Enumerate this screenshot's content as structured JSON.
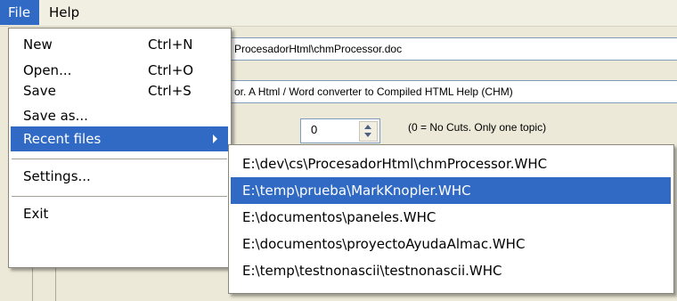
{
  "menubar": {
    "file_label": "File",
    "help_label": "Help"
  },
  "window": {
    "source_file": "ProcesadorHtml\\chmProcessor.doc",
    "title": "or. A Html / Word converter to Compiled HTML Help (CHM)",
    "cut_level": "0",
    "cut_level_hint": "(0 = No Cuts. Only one topic)"
  },
  "file_menu": {
    "new": {
      "label": "New",
      "shortcut": "Ctrl+N"
    },
    "open": {
      "label": "Open...",
      "shortcut": "Ctrl+O"
    },
    "save": {
      "label": "Save",
      "shortcut": "Ctrl+S"
    },
    "save_as": {
      "label": "Save as..."
    },
    "recent": {
      "label": "Recent files"
    },
    "settings": {
      "label": "Settings..."
    },
    "exit": {
      "label": "Exit"
    }
  },
  "recent_files": [
    "E:\\dev\\cs\\ProcesadorHtml\\chmProcessor.WHC",
    "E:\\temp\\prueba\\MarkKnopler.WHC",
    "E:\\documentos\\paneles.WHC",
    "E:\\documentos\\proyectoAyudaAlmac.WHC",
    "E:\\temp\\testnonascii\\testnonascii.WHC"
  ],
  "colors": {
    "highlight": "#316ac5",
    "menubar": "#f1efe2",
    "window": "#ece9d8"
  }
}
